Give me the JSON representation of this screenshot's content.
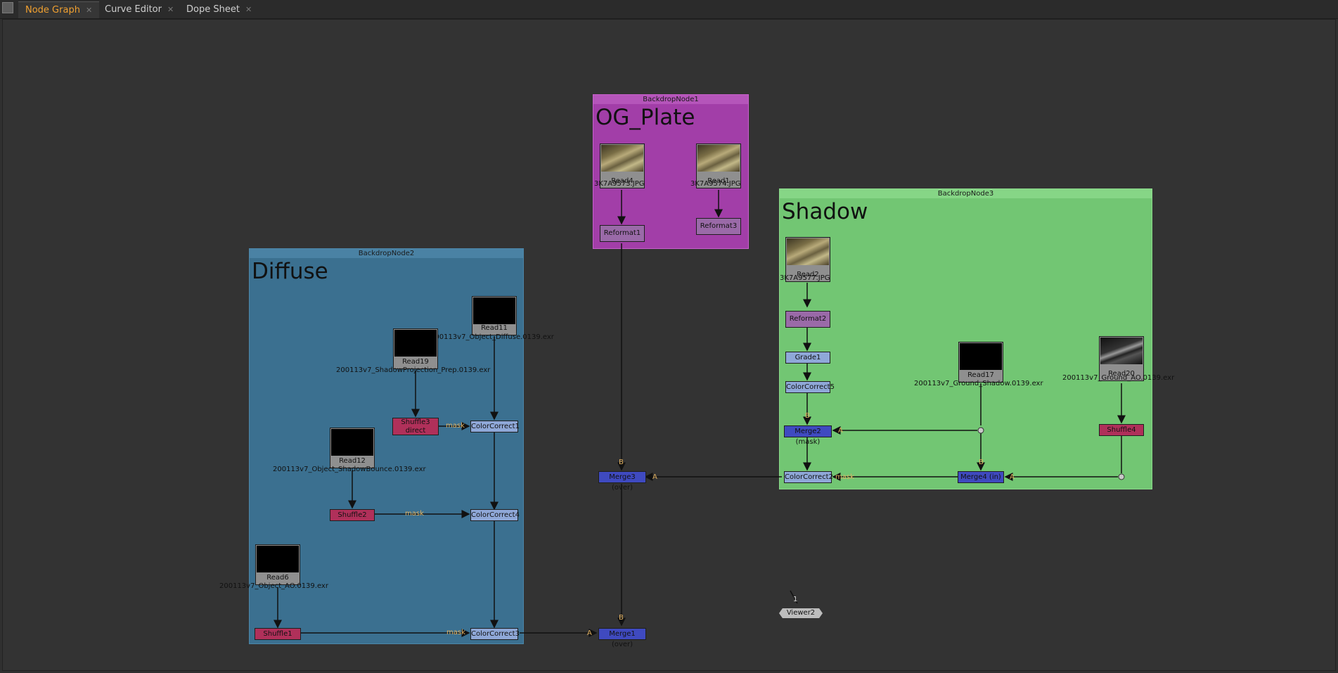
{
  "tabs": [
    {
      "label": "Node Graph",
      "active": true
    },
    {
      "label": "Curve Editor",
      "active": false
    },
    {
      "label": "Dope Sheet",
      "active": false
    }
  ],
  "backdrops": {
    "og": {
      "title": "BackdropNode1",
      "label": "OG_Plate",
      "color": "#a23ea8"
    },
    "diffuse": {
      "title": "BackdropNode2",
      "label": "Diffuse",
      "color": "#3b7090"
    },
    "shadow": {
      "title": "BackdropNode3",
      "label": "Shadow",
      "color": "#72c673"
    }
  },
  "nodes": {
    "read4": {
      "label": "Read4",
      "file": "3K7A9573.JPG"
    },
    "read1": {
      "label": "Read1",
      "file": "3K7A9574.JPG"
    },
    "reformat1": "Reformat1",
    "reformat3": "Reformat3",
    "read2": {
      "label": "Read2",
      "file": "3K7A9577.JPG"
    },
    "reformat2": "Reformat2",
    "grade1": "Grade1",
    "colorcorrect5": "ColorCorrect5",
    "merge2": "Merge2 (mask)",
    "colorcorrect2": "ColorCorrect2",
    "read17": {
      "label": "Read17",
      "file": "200113v7_Ground_Shadow.0139.exr"
    },
    "merge4": "Merge4 (in)",
    "read20": {
      "label": "Read20",
      "file": "200113v7_Ground_AO.0139.exr"
    },
    "shuffle4": "Shuffle4",
    "read11": {
      "label": "Read11",
      "file": "200113v7_Object_Diffuse.0139.exr"
    },
    "read19": {
      "label": "Read19",
      "file": "200113v7_ShadowProjection_Prep.0139.exr"
    },
    "shuffle3": {
      "label": "Shuffle3",
      "sub": "direct"
    },
    "colorcorrect1": "ColorCorrect1",
    "read12": {
      "label": "Read12",
      "file": "200113v7_Object_ShadowBounce.0139.exr"
    },
    "shuffle2": "Shuffle2",
    "colorcorrect4": "ColorCorrect4",
    "read6": {
      "label": "Read6",
      "file": "200113v7_Object_AO.0139.exr"
    },
    "shuffle1": "Shuffle1",
    "colorcorrect3": "ColorCorrect3",
    "merge3": "Merge3 (over)",
    "merge1": "Merge1 (over)",
    "viewer2": "Viewer2"
  },
  "wire_labels": {
    "mask": "mask",
    "a": "A",
    "b": "B",
    "input1": "1"
  },
  "colors": {
    "accent_tab": "#f0a030",
    "merge": "#3f4ac0",
    "shuffle": "#b0305a",
    "colorcorrect": "#8fa8d8",
    "reformat": "#9a6aa8"
  }
}
